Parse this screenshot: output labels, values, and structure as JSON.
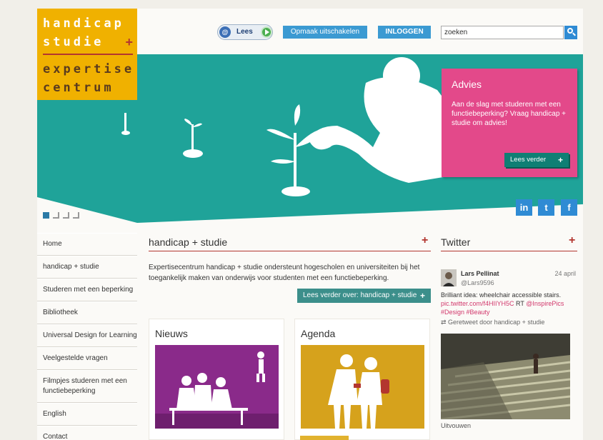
{
  "logo": {
    "line1": "handicap",
    "line2": "studie",
    "plus": "+",
    "line3": "expertise",
    "line4": "centrum"
  },
  "topbar": {
    "lees_voor": "Lees voor",
    "opmaak": "Opmaak uitschakelen",
    "inloggen": "INLOGGEN",
    "search_value": "zoeken"
  },
  "advies": {
    "title": "Advies",
    "text": "Aan de slag met studeren met een functiebeperking? Vraag handicap + studie om advies!",
    "button": "Lees verder",
    "button_plus": "+"
  },
  "social": {
    "linkedin": "in",
    "twitter": "t",
    "facebook": "f"
  },
  "nav": {
    "items": [
      "Home",
      "handicap + studie",
      "Studeren met een beperking",
      "Bibliotheek",
      "Universal Design for Learning",
      "Veelgestelde vragen",
      "Filmpjes studeren met een functiebeperking",
      "English",
      "Contact"
    ]
  },
  "main": {
    "title": "handicap + studie",
    "plus": "+",
    "text": "Expertisecentrum handicap + studie ondersteunt hogescholen en universiteiten bij het toegankelijk maken van onderwijs voor studenten met een functiebeperking.",
    "button": "Lees verder over: handicap + studie",
    "button_plus": "+",
    "nieuws": "Nieuws",
    "agenda": "Agenda"
  },
  "twitter": {
    "title": "Twitter",
    "plus": "+",
    "name": "Lars Pellinat",
    "handle": "@Lars9596",
    "date": "24 april",
    "text": "Brilliant idea: wheelchair accessible stairs.",
    "link": "pic.twitter.com/f4HIIYH5C",
    "rt_prefix": "RT",
    "mention": "@InspirePics",
    "tags": "#Design #Beauty",
    "retweeted": "Geretweet door handicap + studie",
    "uitvouwen": "Uitvouwen"
  },
  "colors": {
    "teal": "#1fa399",
    "pink": "#e3498a",
    "gold": "#f0b100",
    "red": "#b3362f",
    "blue": "#3b9ad2",
    "purple": "#8a2a8a",
    "mustard": "#d6a21c"
  }
}
